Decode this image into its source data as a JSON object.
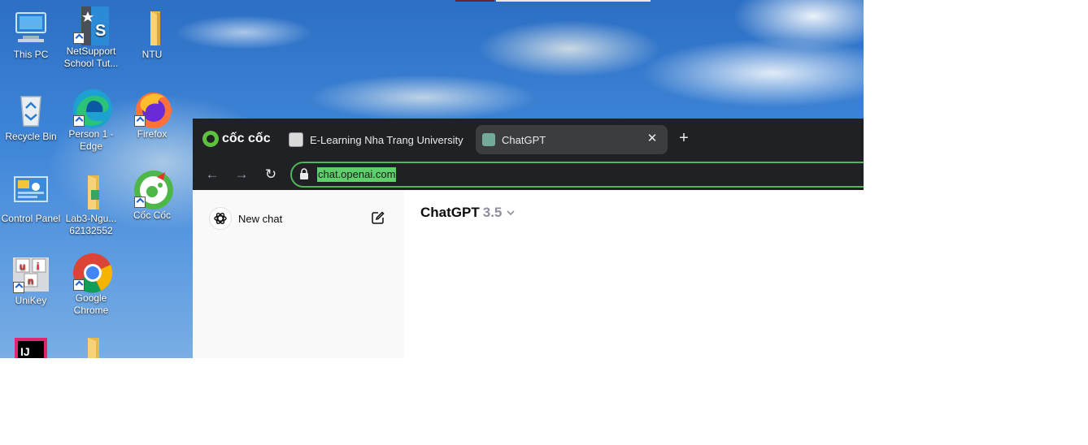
{
  "desktop": {
    "icons": [
      {
        "label": "This PC",
        "icon": "pc-icon"
      },
      {
        "label": "NetSupport School Tut...",
        "icon": "netsupport-icon"
      },
      {
        "label": "NTU",
        "icon": "folder-icon"
      },
      {
        "label": "Recycle Bin",
        "icon": "recycle-bin-icon"
      },
      {
        "label": "Person 1 - Edge",
        "icon": "edge-icon"
      },
      {
        "label": "Firefox",
        "icon": "firefox-icon"
      },
      {
        "label": "Control Panel",
        "icon": "control-panel-icon"
      },
      {
        "label": "Lab3-Ngu... 62132552",
        "icon": "folder-icon"
      },
      {
        "label": "Cốc Cốc",
        "icon": "coccoc-icon"
      },
      {
        "label": "UniKey",
        "icon": "unikey-icon"
      },
      {
        "label": "Google Chrome",
        "icon": "chrome-icon"
      },
      {
        "label": "",
        "icon": "intellij-icon"
      },
      {
        "label": "",
        "icon": "folder-icon"
      }
    ]
  },
  "browser": {
    "brand": "cốc cốc",
    "tabs": [
      {
        "label": "E-Learning Nha Trang University",
        "active": false
      },
      {
        "label": "ChatGPT",
        "active": true
      }
    ],
    "url": "chat.openai.com"
  },
  "chatgpt": {
    "new_chat_label": "New chat",
    "model_name": "ChatGPT",
    "model_version": "3.5"
  },
  "colors": {
    "accent_green": "#51b45a",
    "browser_dark": "#202124",
    "sidebar_bg": "#f9f9f9"
  }
}
